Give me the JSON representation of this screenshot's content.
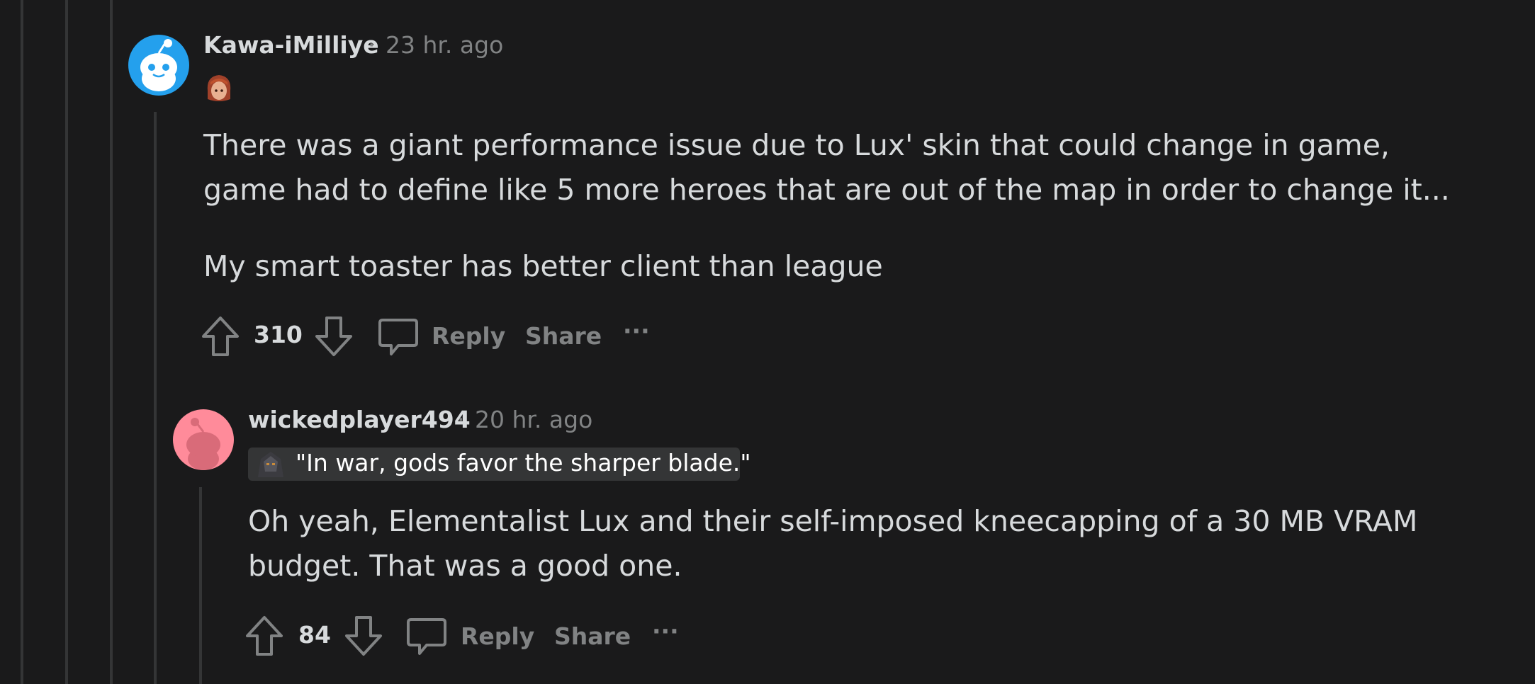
{
  "comment1": {
    "username": "Kawa-iMilliye",
    "separator": "·",
    "time": "23 hr. ago",
    "paragraphs": [
      "There was a giant performance issue due to Lux' skin that could change in game, game had to define like 5 more heroes that are out of the map in order to change it...",
      "My smart toaster has better client than league"
    ],
    "score": "310",
    "reply_label": "Reply",
    "share_label": "Share",
    "more_label": "···"
  },
  "comment2": {
    "username": "wickedplayer494",
    "separator": "·",
    "time": "20 hr. ago",
    "flair": "\"In war, gods favor the sharper blade.\"",
    "paragraphs": [
      "Oh yeah, Elementalist Lux and their self-imposed kneecapping of a 30 MB VRAM budget. That was a good one."
    ],
    "score": "84",
    "reply_label": "Reply",
    "share_label": "Share",
    "more_label": "···"
  },
  "colors": {
    "background": "#1a1a1b",
    "thread_line": "#343536",
    "text": "#d7dadc",
    "muted": "#818384",
    "avatar1_bg": "#24a0ed",
    "avatar2_bg": "#ff8b9a"
  }
}
